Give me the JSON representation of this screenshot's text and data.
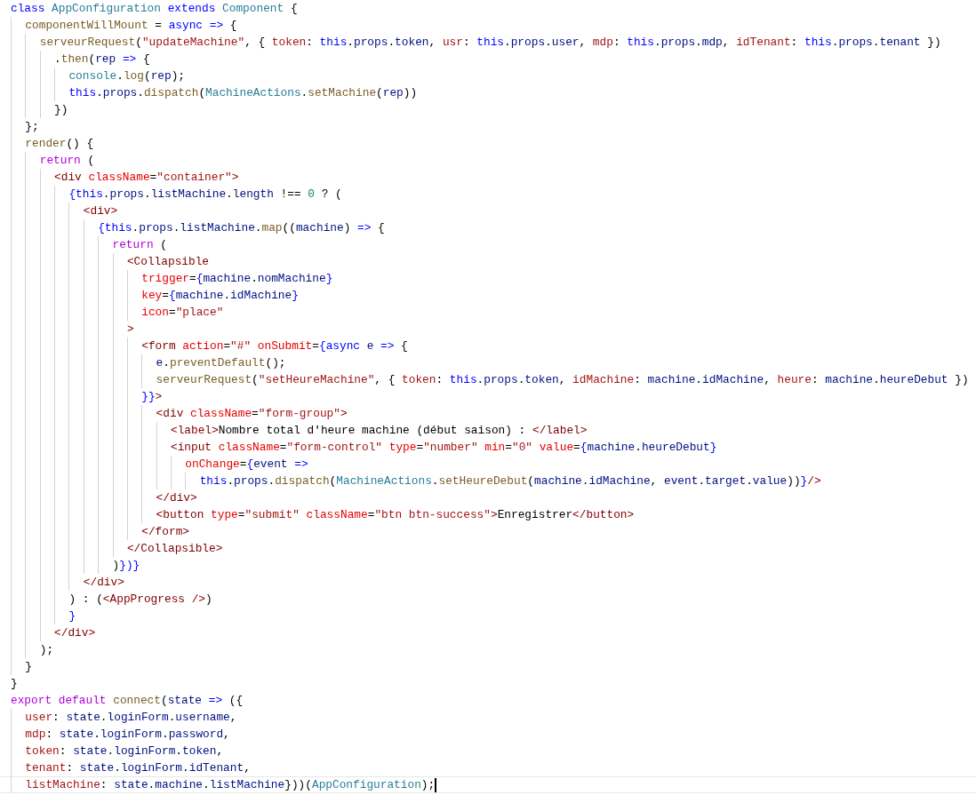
{
  "editor": {
    "lines": [
      {
        "cursor": false,
        "tokens": [
          {
            "kind": "kw",
            "text": "class "
          },
          {
            "kind": "type",
            "text": "AppConfiguration "
          },
          {
            "kind": "kw",
            "text": "extends "
          },
          {
            "kind": "type",
            "text": "Component"
          },
          {
            "kind": "p",
            "text": " {"
          }
        ]
      },
      {
        "cursor": false,
        "tokens": [
          {
            "kind": "fn",
            "text": "  componentWillMount"
          },
          {
            "kind": "p",
            "text": " = "
          },
          {
            "kind": "kw",
            "text": "async => "
          },
          {
            "kind": "p",
            "text": "{"
          }
        ]
      },
      {
        "cursor": false,
        "tokens": [
          {
            "kind": "fn",
            "text": "    serveurRequest"
          },
          {
            "kind": "p",
            "text": "("
          },
          {
            "kind": "str",
            "text": "\"updateMachine\""
          },
          {
            "kind": "p",
            "text": ", { "
          },
          {
            "kind": "key",
            "text": "token"
          },
          {
            "kind": "p",
            "text": ": "
          },
          {
            "kind": "kw",
            "text": "this"
          },
          {
            "kind": "p",
            "text": "."
          },
          {
            "kind": "var",
            "text": "props"
          },
          {
            "kind": "p",
            "text": "."
          },
          {
            "kind": "var",
            "text": "token"
          },
          {
            "kind": "p",
            "text": ", "
          },
          {
            "kind": "key",
            "text": "usr"
          },
          {
            "kind": "p",
            "text": ": "
          },
          {
            "kind": "kw",
            "text": "this"
          },
          {
            "kind": "p",
            "text": "."
          },
          {
            "kind": "var",
            "text": "props"
          },
          {
            "kind": "p",
            "text": "."
          },
          {
            "kind": "var",
            "text": "user"
          },
          {
            "kind": "p",
            "text": ", "
          },
          {
            "kind": "key",
            "text": "mdp"
          },
          {
            "kind": "p",
            "text": ": "
          },
          {
            "kind": "kw",
            "text": "this"
          },
          {
            "kind": "p",
            "text": "."
          },
          {
            "kind": "var",
            "text": "props"
          },
          {
            "kind": "p",
            "text": "."
          },
          {
            "kind": "var",
            "text": "mdp"
          },
          {
            "kind": "p",
            "text": ", "
          },
          {
            "kind": "key",
            "text": "idTenant"
          },
          {
            "kind": "p",
            "text": ": "
          },
          {
            "kind": "kw",
            "text": "this"
          },
          {
            "kind": "p",
            "text": "."
          },
          {
            "kind": "var",
            "text": "props"
          },
          {
            "kind": "p",
            "text": "."
          },
          {
            "kind": "var",
            "text": "tenant"
          },
          {
            "kind": "p",
            "text": " })"
          }
        ]
      },
      {
        "cursor": false,
        "tokens": [
          {
            "kind": "p",
            "text": "      ."
          },
          {
            "kind": "fn",
            "text": "then"
          },
          {
            "kind": "p",
            "text": "("
          },
          {
            "kind": "var",
            "text": "rep "
          },
          {
            "kind": "kw",
            "text": "=>"
          },
          {
            "kind": "p",
            "text": " {"
          }
        ]
      },
      {
        "cursor": false,
        "tokens": [
          {
            "kind": "type",
            "text": "        console"
          },
          {
            "kind": "p",
            "text": "."
          },
          {
            "kind": "fn",
            "text": "log"
          },
          {
            "kind": "p",
            "text": "("
          },
          {
            "kind": "var",
            "text": "rep"
          },
          {
            "kind": "p",
            "text": ");"
          }
        ]
      },
      {
        "cursor": false,
        "tokens": [
          {
            "kind": "kw",
            "text": "        this"
          },
          {
            "kind": "p",
            "text": "."
          },
          {
            "kind": "var",
            "text": "props"
          },
          {
            "kind": "p",
            "text": "."
          },
          {
            "kind": "fn",
            "text": "dispatch"
          },
          {
            "kind": "p",
            "text": "("
          },
          {
            "kind": "type",
            "text": "MachineActions"
          },
          {
            "kind": "p",
            "text": "."
          },
          {
            "kind": "fn",
            "text": "setMachine"
          },
          {
            "kind": "p",
            "text": "("
          },
          {
            "kind": "var",
            "text": "rep"
          },
          {
            "kind": "p",
            "text": "))"
          }
        ]
      },
      {
        "cursor": false,
        "tokens": [
          {
            "kind": "p",
            "text": "      })"
          }
        ]
      },
      {
        "cursor": false,
        "tokens": [
          {
            "kind": "p",
            "text": "  };"
          }
        ]
      },
      {
        "cursor": false,
        "tokens": [
          {
            "kind": "fn",
            "text": "  render"
          },
          {
            "kind": "p",
            "text": "() {"
          }
        ]
      },
      {
        "cursor": false,
        "tokens": [
          {
            "kind": "ctl",
            "text": "    return"
          },
          {
            "kind": "p",
            "text": " ("
          }
        ]
      },
      {
        "cursor": false,
        "tokens": [
          {
            "kind": "tag",
            "text": "      <div"
          },
          {
            "kind": "attr",
            "text": " className"
          },
          {
            "kind": "p",
            "text": "="
          },
          {
            "kind": "str",
            "text": "\"container\""
          },
          {
            "kind": "tag",
            "text": ">"
          }
        ]
      },
      {
        "cursor": false,
        "tokens": [
          {
            "kind": "kw",
            "text": "        {this"
          },
          {
            "kind": "p",
            "text": "."
          },
          {
            "kind": "var",
            "text": "props"
          },
          {
            "kind": "p",
            "text": "."
          },
          {
            "kind": "var",
            "text": "listMachine"
          },
          {
            "kind": "p",
            "text": "."
          },
          {
            "kind": "var",
            "text": "length"
          },
          {
            "kind": "p",
            "text": " !== "
          },
          {
            "kind": "num",
            "text": "0"
          },
          {
            "kind": "p",
            "text": " ? ("
          }
        ]
      },
      {
        "cursor": false,
        "tokens": [
          {
            "kind": "tag",
            "text": "          <div>"
          }
        ]
      },
      {
        "cursor": false,
        "tokens": [
          {
            "kind": "kw",
            "text": "            {this"
          },
          {
            "kind": "p",
            "text": "."
          },
          {
            "kind": "var",
            "text": "props"
          },
          {
            "kind": "p",
            "text": "."
          },
          {
            "kind": "var",
            "text": "listMachine"
          },
          {
            "kind": "p",
            "text": "."
          },
          {
            "kind": "fn",
            "text": "map"
          },
          {
            "kind": "p",
            "text": "(("
          },
          {
            "kind": "var",
            "text": "machine"
          },
          {
            "kind": "p",
            "text": ") "
          },
          {
            "kind": "kw",
            "text": "=>"
          },
          {
            "kind": "p",
            "text": " {"
          }
        ]
      },
      {
        "cursor": false,
        "tokens": [
          {
            "kind": "ctl",
            "text": "              return"
          },
          {
            "kind": "p",
            "text": " ("
          }
        ]
      },
      {
        "cursor": false,
        "tokens": [
          {
            "kind": "tag",
            "text": "                <Collapsible"
          }
        ]
      },
      {
        "cursor": false,
        "tokens": [
          {
            "kind": "attr",
            "text": "                  trigger"
          },
          {
            "kind": "p",
            "text": "="
          },
          {
            "kind": "kw",
            "text": "{"
          },
          {
            "kind": "var",
            "text": "machine"
          },
          {
            "kind": "p",
            "text": "."
          },
          {
            "kind": "var",
            "text": "nomMachine"
          },
          {
            "kind": "kw",
            "text": "}"
          }
        ]
      },
      {
        "cursor": false,
        "tokens": [
          {
            "kind": "attr",
            "text": "                  key"
          },
          {
            "kind": "p",
            "text": "="
          },
          {
            "kind": "kw",
            "text": "{"
          },
          {
            "kind": "var",
            "text": "machine"
          },
          {
            "kind": "p",
            "text": "."
          },
          {
            "kind": "var",
            "text": "idMachine"
          },
          {
            "kind": "kw",
            "text": "}"
          }
        ]
      },
      {
        "cursor": false,
        "tokens": [
          {
            "kind": "attr",
            "text": "                  icon"
          },
          {
            "kind": "p",
            "text": "="
          },
          {
            "kind": "str",
            "text": "\"place\""
          }
        ]
      },
      {
        "cursor": false,
        "tokens": [
          {
            "kind": "tag",
            "text": "                >"
          }
        ]
      },
      {
        "cursor": false,
        "tokens": [
          {
            "kind": "tag",
            "text": "                  <form"
          },
          {
            "kind": "attr",
            "text": " action"
          },
          {
            "kind": "p",
            "text": "="
          },
          {
            "kind": "str",
            "text": "\"#\""
          },
          {
            "kind": "attr",
            "text": " onSubmit"
          },
          {
            "kind": "p",
            "text": "="
          },
          {
            "kind": "kw",
            "text": "{async "
          },
          {
            "kind": "var",
            "text": "e "
          },
          {
            "kind": "kw",
            "text": "=>"
          },
          {
            "kind": "p",
            "text": " {"
          }
        ]
      },
      {
        "cursor": false,
        "tokens": [
          {
            "kind": "var",
            "text": "                    e"
          },
          {
            "kind": "p",
            "text": "."
          },
          {
            "kind": "fn",
            "text": "preventDefault"
          },
          {
            "kind": "p",
            "text": "();"
          }
        ]
      },
      {
        "cursor": false,
        "tokens": [
          {
            "kind": "fn",
            "text": "                    serveurRequest"
          },
          {
            "kind": "p",
            "text": "("
          },
          {
            "kind": "str",
            "text": "\"setHeureMachine\""
          },
          {
            "kind": "p",
            "text": ", { "
          },
          {
            "kind": "key",
            "text": "token"
          },
          {
            "kind": "p",
            "text": ": "
          },
          {
            "kind": "kw",
            "text": "this"
          },
          {
            "kind": "p",
            "text": "."
          },
          {
            "kind": "var",
            "text": "props"
          },
          {
            "kind": "p",
            "text": "."
          },
          {
            "kind": "var",
            "text": "token"
          },
          {
            "kind": "p",
            "text": ", "
          },
          {
            "kind": "key",
            "text": "idMachine"
          },
          {
            "kind": "p",
            "text": ": "
          },
          {
            "kind": "var",
            "text": "machine"
          },
          {
            "kind": "p",
            "text": "."
          },
          {
            "kind": "var",
            "text": "idMachine"
          },
          {
            "kind": "p",
            "text": ", "
          },
          {
            "kind": "key",
            "text": "heure"
          },
          {
            "kind": "p",
            "text": ": "
          },
          {
            "kind": "var",
            "text": "machine"
          },
          {
            "kind": "p",
            "text": "."
          },
          {
            "kind": "var",
            "text": "heureDebut"
          },
          {
            "kind": "p",
            "text": " })"
          }
        ]
      },
      {
        "cursor": false,
        "tokens": [
          {
            "kind": "kw",
            "text": "                  }}"
          },
          {
            "kind": "tag",
            "text": ">"
          }
        ]
      },
      {
        "cursor": false,
        "tokens": [
          {
            "kind": "tag",
            "text": "                    <div"
          },
          {
            "kind": "attr",
            "text": " className"
          },
          {
            "kind": "p",
            "text": "="
          },
          {
            "kind": "str",
            "text": "\"form-group\""
          },
          {
            "kind": "tag",
            "text": ">"
          }
        ]
      },
      {
        "cursor": false,
        "tokens": [
          {
            "kind": "tag",
            "text": "                      <label>"
          },
          {
            "kind": "p",
            "text": "Nombre total d'heure machine (début saison) : "
          },
          {
            "kind": "tag",
            "text": "</label>"
          }
        ]
      },
      {
        "cursor": false,
        "tokens": [
          {
            "kind": "tag",
            "text": "                      <input"
          },
          {
            "kind": "attr",
            "text": " className"
          },
          {
            "kind": "p",
            "text": "="
          },
          {
            "kind": "str",
            "text": "\"form-control\""
          },
          {
            "kind": "attr",
            "text": " type"
          },
          {
            "kind": "p",
            "text": "="
          },
          {
            "kind": "str",
            "text": "\"number\""
          },
          {
            "kind": "attr",
            "text": " min"
          },
          {
            "kind": "p",
            "text": "="
          },
          {
            "kind": "str",
            "text": "\"0\""
          },
          {
            "kind": "attr",
            "text": " value"
          },
          {
            "kind": "p",
            "text": "="
          },
          {
            "kind": "kw",
            "text": "{"
          },
          {
            "kind": "var",
            "text": "machine"
          },
          {
            "kind": "p",
            "text": "."
          },
          {
            "kind": "var",
            "text": "heureDebut"
          },
          {
            "kind": "kw",
            "text": "}"
          }
        ]
      },
      {
        "cursor": false,
        "tokens": [
          {
            "kind": "attr",
            "text": "                        onChange"
          },
          {
            "kind": "p",
            "text": "="
          },
          {
            "kind": "kw",
            "text": "{"
          },
          {
            "kind": "var",
            "text": "event "
          },
          {
            "kind": "kw",
            "text": "=>"
          }
        ]
      },
      {
        "cursor": false,
        "tokens": [
          {
            "kind": "kw",
            "text": "                          this"
          },
          {
            "kind": "p",
            "text": "."
          },
          {
            "kind": "var",
            "text": "props"
          },
          {
            "kind": "p",
            "text": "."
          },
          {
            "kind": "fn",
            "text": "dispatch"
          },
          {
            "kind": "p",
            "text": "("
          },
          {
            "kind": "type",
            "text": "MachineActions"
          },
          {
            "kind": "p",
            "text": "."
          },
          {
            "kind": "fn",
            "text": "setHeureDebut"
          },
          {
            "kind": "p",
            "text": "("
          },
          {
            "kind": "var",
            "text": "machine"
          },
          {
            "kind": "p",
            "text": "."
          },
          {
            "kind": "var",
            "text": "idMachine"
          },
          {
            "kind": "p",
            "text": ", "
          },
          {
            "kind": "var",
            "text": "event"
          },
          {
            "kind": "p",
            "text": "."
          },
          {
            "kind": "var",
            "text": "target"
          },
          {
            "kind": "p",
            "text": "."
          },
          {
            "kind": "var",
            "text": "value"
          },
          {
            "kind": "p",
            "text": "))"
          },
          {
            "kind": "kw",
            "text": "}"
          },
          {
            "kind": "tag",
            "text": "/>"
          }
        ]
      },
      {
        "cursor": false,
        "tokens": [
          {
            "kind": "tag",
            "text": "                    </div>"
          }
        ]
      },
      {
        "cursor": false,
        "tokens": [
          {
            "kind": "tag",
            "text": "                    <button"
          },
          {
            "kind": "attr",
            "text": " type"
          },
          {
            "kind": "p",
            "text": "="
          },
          {
            "kind": "str",
            "text": "\"submit\""
          },
          {
            "kind": "attr",
            "text": " className"
          },
          {
            "kind": "p",
            "text": "="
          },
          {
            "kind": "str",
            "text": "\"btn btn-success\""
          },
          {
            "kind": "tag",
            "text": ">"
          },
          {
            "kind": "p",
            "text": "Enregistrer"
          },
          {
            "kind": "tag",
            "text": "</button>"
          }
        ]
      },
      {
        "cursor": false,
        "tokens": [
          {
            "kind": "tag",
            "text": "                  </form>"
          }
        ]
      },
      {
        "cursor": false,
        "tokens": [
          {
            "kind": "tag",
            "text": "                </Collapsible>"
          }
        ]
      },
      {
        "cursor": false,
        "tokens": [
          {
            "kind": "p",
            "text": "              )"
          },
          {
            "kind": "kw",
            "text": "})}"
          }
        ]
      },
      {
        "cursor": false,
        "tokens": [
          {
            "kind": "tag",
            "text": "          </div>"
          }
        ]
      },
      {
        "cursor": false,
        "tokens": [
          {
            "kind": "p",
            "text": "        ) : ("
          },
          {
            "kind": "tag",
            "text": "<AppProgress />"
          },
          {
            "kind": "p",
            "text": ")"
          }
        ]
      },
      {
        "cursor": false,
        "tokens": [
          {
            "kind": "kw",
            "text": "        }"
          }
        ]
      },
      {
        "cursor": false,
        "tokens": [
          {
            "kind": "tag",
            "text": "      </div>"
          }
        ]
      },
      {
        "cursor": false,
        "tokens": [
          {
            "kind": "p",
            "text": "    );"
          }
        ]
      },
      {
        "cursor": false,
        "tokens": [
          {
            "kind": "p",
            "text": "  }"
          }
        ]
      },
      {
        "cursor": false,
        "tokens": [
          {
            "kind": "p",
            "text": "}"
          }
        ]
      },
      {
        "cursor": false,
        "tokens": [
          {
            "kind": "ctl",
            "text": "export default "
          },
          {
            "kind": "fn",
            "text": "connect"
          },
          {
            "kind": "p",
            "text": "("
          },
          {
            "kind": "var",
            "text": "state "
          },
          {
            "kind": "kw",
            "text": "=>"
          },
          {
            "kind": "p",
            "text": " ({"
          }
        ]
      },
      {
        "cursor": false,
        "tokens": [
          {
            "kind": "key",
            "text": "  user"
          },
          {
            "kind": "p",
            "text": ": "
          },
          {
            "kind": "var",
            "text": "state"
          },
          {
            "kind": "p",
            "text": "."
          },
          {
            "kind": "var",
            "text": "loginForm"
          },
          {
            "kind": "p",
            "text": "."
          },
          {
            "kind": "var",
            "text": "username"
          },
          {
            "kind": "p",
            "text": ","
          }
        ]
      },
      {
        "cursor": false,
        "tokens": [
          {
            "kind": "key",
            "text": "  mdp"
          },
          {
            "kind": "p",
            "text": ": "
          },
          {
            "kind": "var",
            "text": "state"
          },
          {
            "kind": "p",
            "text": "."
          },
          {
            "kind": "var",
            "text": "loginForm"
          },
          {
            "kind": "p",
            "text": "."
          },
          {
            "kind": "var",
            "text": "password"
          },
          {
            "kind": "p",
            "text": ","
          }
        ]
      },
      {
        "cursor": false,
        "tokens": [
          {
            "kind": "key",
            "text": "  token"
          },
          {
            "kind": "p",
            "text": ": "
          },
          {
            "kind": "var",
            "text": "state"
          },
          {
            "kind": "p",
            "text": "."
          },
          {
            "kind": "var",
            "text": "loginForm"
          },
          {
            "kind": "p",
            "text": "."
          },
          {
            "kind": "var",
            "text": "token"
          },
          {
            "kind": "p",
            "text": ","
          }
        ]
      },
      {
        "cursor": false,
        "tokens": [
          {
            "kind": "key",
            "text": "  tenant"
          },
          {
            "kind": "p",
            "text": ": "
          },
          {
            "kind": "var",
            "text": "state"
          },
          {
            "kind": "p",
            "text": "."
          },
          {
            "kind": "var",
            "text": "loginForm"
          },
          {
            "kind": "p",
            "text": "."
          },
          {
            "kind": "var",
            "text": "idTenant"
          },
          {
            "kind": "p",
            "text": ","
          }
        ]
      },
      {
        "cursor": true,
        "tokens": [
          {
            "kind": "key",
            "text": "  listMachine"
          },
          {
            "kind": "p",
            "text": ": "
          },
          {
            "kind": "var",
            "text": "state"
          },
          {
            "kind": "p",
            "text": "."
          },
          {
            "kind": "var",
            "text": "machine"
          },
          {
            "kind": "p",
            "text": "."
          },
          {
            "kind": "var",
            "text": "listMachine"
          },
          {
            "kind": "p",
            "text": "}))("
          },
          {
            "kind": "type",
            "text": "AppConfiguration"
          },
          {
            "kind": "p",
            "text": ");"
          }
        ]
      }
    ]
  }
}
